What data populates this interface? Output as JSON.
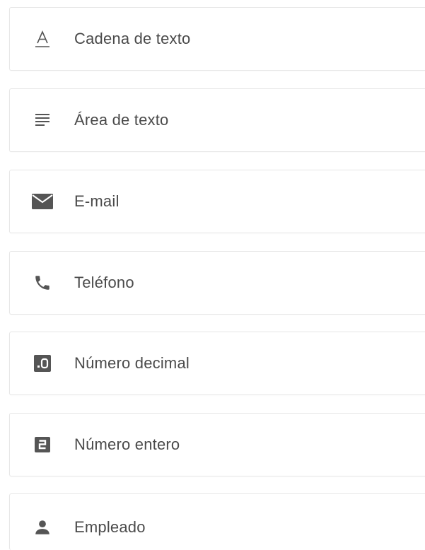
{
  "field_types": [
    {
      "label": "Cadena de texto",
      "icon": "text-string-icon"
    },
    {
      "label": "Área de texto",
      "icon": "text-area-icon"
    },
    {
      "label": "E-mail",
      "icon": "email-icon"
    },
    {
      "label": "Teléfono",
      "icon": "phone-icon"
    },
    {
      "label": "Número decimal",
      "icon": "decimal-number-icon"
    },
    {
      "label": "Número entero",
      "icon": "integer-number-icon"
    },
    {
      "label": "Empleado",
      "icon": "employee-icon"
    }
  ],
  "colors": {
    "icon": "#555555",
    "text": "#4a4a4a",
    "border": "#e6e6e6"
  }
}
